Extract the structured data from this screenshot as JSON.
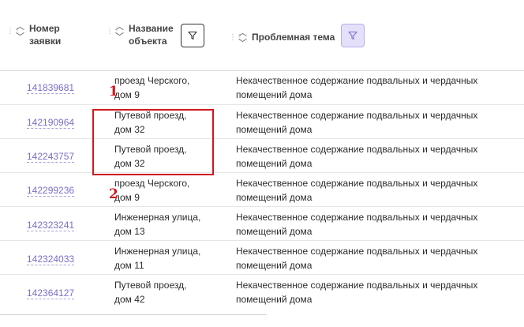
{
  "header": {
    "col1": {
      "line1": "Номер",
      "line2": "заявки"
    },
    "col2": {
      "line1": "Название",
      "line2": "объекта"
    },
    "col3": {
      "title": "Проблемная тема"
    }
  },
  "rows": [
    {
      "id": "141839681",
      "object_l1": "проезд Черского,",
      "object_l2": "дом 9",
      "topic_l1": "Некачественное содержание подвальных и чердачных",
      "topic_l2": "помещений дома"
    },
    {
      "id": "142190964",
      "object_l1": "Путевой проезд,",
      "object_l2": "дом 32",
      "topic_l1": "Некачественное содержание подвальных и чердачных",
      "topic_l2": "помещений дома"
    },
    {
      "id": "142243757",
      "object_l1": "Путевой проезд,",
      "object_l2": "дом 32",
      "topic_l1": "Некачественное содержание подвальных и чердачных",
      "topic_l2": "помещений дома"
    },
    {
      "id": "142299236",
      "object_l1": "проезд Черского,",
      "object_l2": "дом 9",
      "topic_l1": "Некачественное содержание подвальных и чердачных",
      "topic_l2": "помещений дома"
    },
    {
      "id": "142323241",
      "object_l1": "Инженерная улица,",
      "object_l2": "дом 13",
      "topic_l1": "Некачественное содержание подвальных и чердачных",
      "topic_l2": "помещений дома"
    },
    {
      "id": "142324033",
      "object_l1": "Инженерная улица,",
      "object_l2": "дом 11",
      "topic_l1": "Некачественное содержание подвальных и чердачных",
      "topic_l2": "помещений дома"
    },
    {
      "id": "142364127",
      "object_l1": "Путевой проезд,",
      "object_l2": "дом 42",
      "topic_l1": "Некачественное содержание подвальных и чердачных",
      "topic_l2": "помещений дома"
    }
  ],
  "annotations": {
    "marker1": "1",
    "marker2": "2"
  },
  "icons": {
    "grip": "drag-grip-icon",
    "sort_up": "chevron-up-icon",
    "sort_down": "chevron-down-icon",
    "filter": "funnel-icon"
  },
  "colors": {
    "link": "#7a6fc7",
    "annotation": "#d0191f",
    "filter_active_bg": "#e4e0fa"
  }
}
